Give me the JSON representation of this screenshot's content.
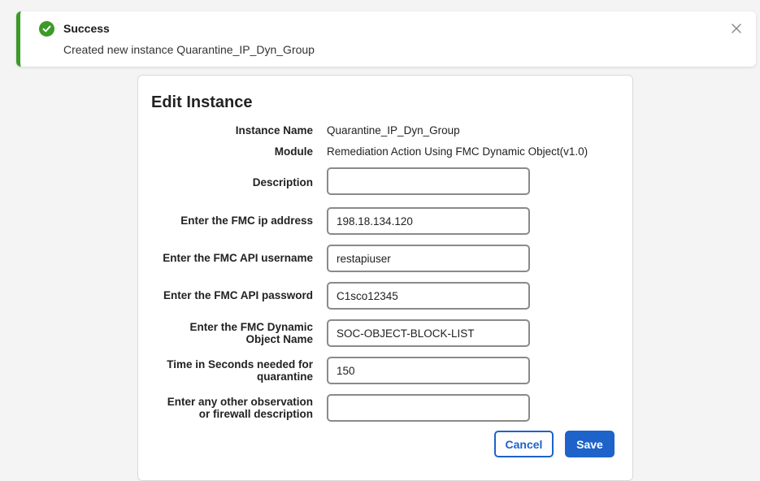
{
  "toast": {
    "title": "Success",
    "message": "Created new instance Quarantine_IP_Dyn_Group",
    "status_color": "#3c9a28",
    "icon": "check-circle-icon",
    "close_icon": "close-icon"
  },
  "form": {
    "title": "Edit Instance",
    "instance_name_label": "Instance Name",
    "instance_name_value": "Quarantine_IP_Dyn_Group",
    "module_label": "Module",
    "module_value": "Remediation Action Using FMC Dynamic Object(v1.0)",
    "description_label": "Description",
    "description_value": "",
    "fmc_ip_label": "Enter the FMC ip address",
    "fmc_ip_value": "198.18.134.120",
    "api_username_label": "Enter the FMC API username",
    "api_username_value": "restapiuser",
    "api_password_label": "Enter the FMC API password",
    "api_password_value": "C1sco12345",
    "dyn_object_label_1": "Enter the FMC Dynamic",
    "dyn_object_label_2": "Object Name",
    "dyn_object_value": "SOC-OBJECT-BLOCK-LIST",
    "quarantine_time_label_1": "Time in Seconds needed for",
    "quarantine_time_label_2": "quarantine",
    "quarantine_time_value": "150",
    "observation_label_1": "Enter any other observation",
    "observation_label_2": "or firewall description",
    "observation_value": "",
    "cancel_label": "Cancel",
    "save_label": "Save",
    "accent_color": "#1d63c9"
  }
}
